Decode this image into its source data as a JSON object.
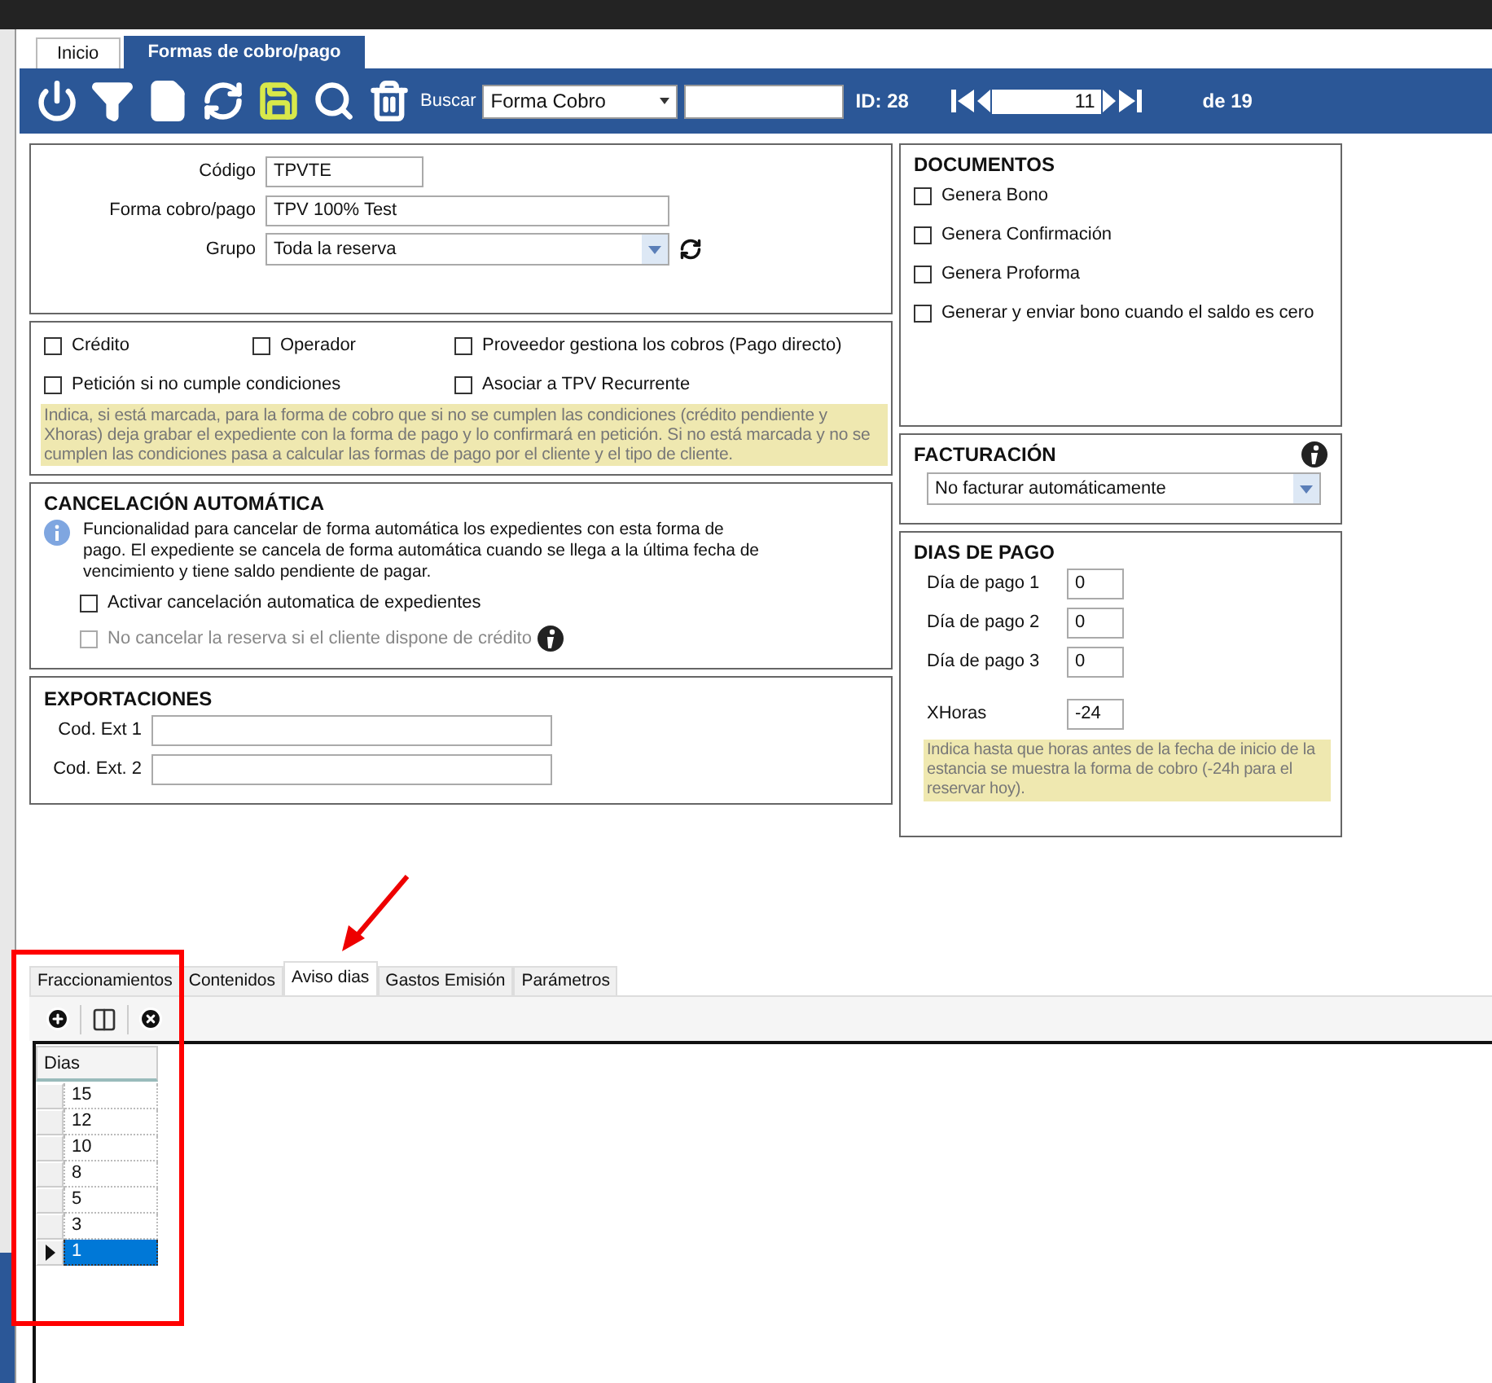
{
  "tabs": [
    {
      "label": "Inicio",
      "selected": false
    },
    {
      "label": "Formas de cobro/pago",
      "selected": true
    }
  ],
  "toolbar": {
    "search_label": "Buscar",
    "search_field": "Forma Cobro",
    "id": "ID: 28",
    "page": "11",
    "total": "de 19"
  },
  "general": {
    "fields": [
      {
        "label": "Código",
        "value": "TPVTE",
        "kind": "short"
      },
      {
        "label": "Forma cobro/pago",
        "value": "TPV 100% Test",
        "kind": "long"
      },
      {
        "label": "Grupo",
        "value": "Toda la reserva",
        "kind": "select"
      }
    ]
  },
  "options": {
    "checkboxes": [
      {
        "label": "Crédito",
        "checked": false
      },
      {
        "label": "Operador",
        "checked": false
      },
      {
        "label": "Proveedor gestiona los cobros (Pago directo)",
        "checked": false
      },
      {
        "label": "Petición si no cumple condiciones",
        "checked": false
      },
      {
        "label": "Asociar a TPV Recurrente",
        "checked": false
      }
    ],
    "note": "Indica, si está marcada, para la forma de cobro que si no se cumplen las condiciones (crédito pendiente y Xhoras) deja grabar el expediente con la forma de pago y lo confirmará en petición. Si no está marcada y no se cumplen las condiciones pasa a calcular las formas de pago por el cliente y el tipo de cliente."
  },
  "cancelacion": {
    "title": "CANCELACIÓN AUTOMÁTICA",
    "description": "Funcionalidad para cancelar de forma automática los expedientes con esta forma de pago. El expediente se cancela de forma automática cuando se llega a la última fecha de vencimiento y tiene saldo pendiente de pagar.",
    "checkboxes": [
      {
        "label": "Activar cancelación automatica de expedientes",
        "checked": false,
        "disabled": false
      },
      {
        "label": "No cancelar la reserva si el cliente dispone de crédito",
        "checked": false,
        "disabled": true
      }
    ]
  },
  "exportaciones": {
    "title": "EXPORTACIONES",
    "fields": [
      {
        "label": "Cod. Ext 1"
      },
      {
        "label": "Cod. Ext. 2"
      }
    ]
  },
  "documentos": {
    "title": "DOCUMENTOS",
    "checkboxes": [
      {
        "label": "Genera Bono",
        "checked": false
      },
      {
        "label": "Genera Confirmación",
        "checked": false
      },
      {
        "label": "Genera Proforma",
        "checked": false
      },
      {
        "label": "Generar y enviar bono cuando el saldo es cero",
        "checked": false
      }
    ]
  },
  "facturacion": {
    "title": "FACTURACIÓN",
    "value": "No facturar automáticamente"
  },
  "dias_de_pago": {
    "title": "DIAS DE PAGO",
    "fields": [
      {
        "label": "Día de pago 1",
        "value": "0"
      },
      {
        "label": "Día de pago 2",
        "value": "0"
      },
      {
        "label": "Día de pago 3",
        "value": "0"
      },
      {
        "label": "XHoras",
        "value": "-24"
      }
    ],
    "note": "Indica hasta que horas antes de la fecha de inicio de la estancia se muestra la forma de cobro (-24h para el reservar hoy)."
  },
  "bottom_tabs": [
    {
      "label": "Fraccionamientos",
      "selected": false
    },
    {
      "label": "Contenidos",
      "selected": false
    },
    {
      "label": "Aviso dias",
      "selected": true
    },
    {
      "label": "Gastos Emisión",
      "selected": false
    },
    {
      "label": "Parámetros",
      "selected": false
    }
  ],
  "grid": {
    "columns": [
      "Dias"
    ],
    "rows": [
      {
        "value": "15",
        "selected": false
      },
      {
        "value": "12",
        "selected": false
      },
      {
        "value": "10",
        "selected": false
      },
      {
        "value": "8",
        "selected": false
      },
      {
        "value": "5",
        "selected": false
      },
      {
        "value": "3",
        "selected": false
      },
      {
        "value": "1",
        "selected": true
      }
    ]
  }
}
